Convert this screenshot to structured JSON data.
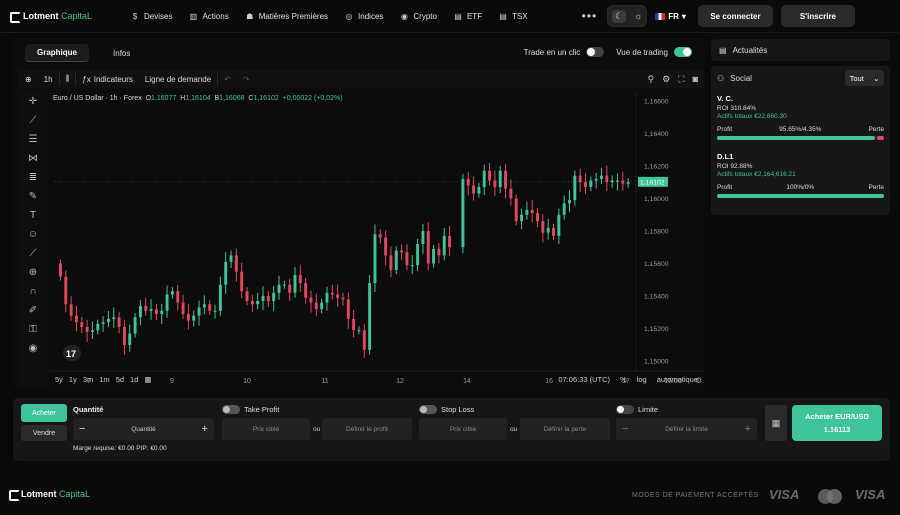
{
  "brand": {
    "name": "Lotment",
    "suffix": "CapitaL"
  },
  "nav": {
    "items": [
      {
        "label": "Devises",
        "icon": "currency-icon"
      },
      {
        "label": "Actions",
        "icon": "stocks-icon"
      },
      {
        "label": "Matières Premières",
        "icon": "commodities-icon"
      },
      {
        "label": "Indices",
        "icon": "indices-icon"
      },
      {
        "label": "Crypto",
        "icon": "crypto-icon"
      },
      {
        "label": "ETF",
        "icon": "etf-icon"
      },
      {
        "label": "TSX",
        "icon": "tsx-icon"
      }
    ],
    "language": "FR",
    "login": "Se connecter",
    "signup": "S'inscrire"
  },
  "chart_panel": {
    "tabs": [
      "Graphique",
      "Infos"
    ],
    "active_tab": "Graphique",
    "toggle_one_click": "Trade en un clic",
    "toggle_trading_view": "Vue de trading",
    "toolbar": {
      "interval": "1h",
      "indicators": "Indicateurs",
      "demand_line": "Ligne de demande"
    },
    "legend": {
      "symbol": "Euro / US Dollar · 1h · Forex",
      "o": "1,16077",
      "h": "1,16104",
      "b": "1,16068",
      "c": "1,16102",
      "change": "+0,00022 (+0,02%)"
    },
    "ranges": [
      "5y",
      "1y",
      "3m",
      "1m",
      "5d",
      "1d"
    ],
    "time": "07:06:33 (UTC)",
    "percent": "%",
    "log": "log",
    "auto": "automatique"
  },
  "chart_data": {
    "type": "candlestick",
    "title": "Euro / US Dollar · 1h · Forex",
    "x_ticks": [
      "7",
      "9",
      "10",
      "11",
      "12",
      "14",
      "16",
      "17",
      "15:00"
    ],
    "y_ticks": [
      "1,16600",
      "1,16400",
      "1,16200",
      "1,16000",
      "1,15800",
      "1,15600",
      "1,15400",
      "1,15200",
      "1,15000"
    ],
    "ylim": [
      1.1494,
      1.1666
    ],
    "last_price": "1,16102",
    "colors": {
      "up": "#3fc39b",
      "down": "#e0485f"
    },
    "closes": [
      1.1552,
      1.1535,
      1.1528,
      1.1524,
      1.1521,
      1.1518,
      1.1519,
      1.1523,
      1.1524,
      1.1526,
      1.1527,
      1.1521,
      1.151,
      1.1517,
      1.1527,
      1.1534,
      1.1531,
      1.1532,
      1.1529,
      1.1531,
      1.1541,
      1.1543,
      1.1536,
      1.1529,
      1.1525,
      1.1528,
      1.1533,
      1.1535,
      1.1531,
      1.1531,
      1.1547,
      1.1561,
      1.1565,
      1.1555,
      1.1543,
      1.1537,
      1.1535,
      1.1537,
      1.154,
      1.1537,
      1.1542,
      1.1547,
      1.1547,
      1.1542,
      1.1553,
      1.1548,
      1.1539,
      1.1536,
      1.1532,
      1.1536,
      1.1542,
      1.1541,
      1.1539,
      1.1538,
      1.1526,
      1.1519,
      1.1519,
      1.1507,
      1.1548,
      1.1578,
      1.1576,
      1.1565,
      1.1556,
      1.1568,
      1.1567,
      1.1559,
      1.1559,
      1.1572,
      1.158,
      1.156,
      1.1569,
      1.1565,
      1.1577,
      1.157,
      1.1612,
      1.1608,
      1.1603,
      1.1607,
      1.1617,
      1.1611,
      1.1607,
      1.1617,
      1.1606,
      1.16,
      1.1586,
      1.159,
      1.1593,
      1.1591,
      1.1586,
      1.1579,
      1.1582,
      1.1577,
      1.159,
      1.1597,
      1.1599,
      1.1614,
      1.161,
      1.1607,
      1.1611,
      1.1612,
      1.1614,
      1.161,
      1.1611,
      1.1611,
      1.1609,
      1.161
    ]
  },
  "sidebar": {
    "news": "Actualités",
    "social": "Social",
    "filter": "Tout",
    "traders": [
      {
        "name": "V. C.",
        "roi": "ROI 310.84%",
        "assets": "Actifs totaux €22,660.30",
        "profit_label": "Profit",
        "ratio": "95.65%/4.35%",
        "loss_label": "Perte",
        "profit_pct": 95.65
      },
      {
        "name": "D.L1",
        "roi": "ROI 92.88%",
        "assets": "Actifs totaux €2,164,616.21",
        "profit_label": "Profit",
        "ratio": "100%/0%",
        "loss_label": "Perte",
        "profit_pct": 100
      }
    ]
  },
  "order": {
    "buy_tab": "Acheter",
    "sell_tab": "Vendre",
    "quantity_label": "Quantité",
    "quantity_placeholder": "Quantité",
    "take_profit": "Take Profit",
    "stop_loss": "Stop Loss",
    "limit": "Limite",
    "target_price": "Prix cible",
    "or": "ou",
    "set_profit": "Définir le profit",
    "set_loss": "Définir la perte",
    "set_limit": "Définir la limite",
    "margin": "Marge requise: €0.00   PIP: €0.00",
    "buy_button": "Acheter EUR/USD",
    "buy_price": "1.16113"
  },
  "footer": {
    "payment_label": "MODES DE PAIEMENT ACCEPTÉS",
    "visa": "VISA"
  }
}
